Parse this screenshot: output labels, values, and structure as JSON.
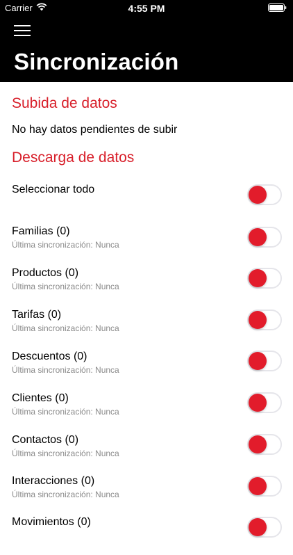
{
  "status_bar": {
    "carrier": "Carrier",
    "time": "4:55 PM",
    "wifi_icon": "wifi-icon",
    "battery_icon": "battery-icon"
  },
  "header": {
    "menu_icon": "hamburger-menu-icon",
    "title": "Sincronización"
  },
  "upload": {
    "title": "Subida de datos",
    "message": "No hay datos pendientes de subir"
  },
  "download": {
    "title": "Descarga de datos",
    "select_all": {
      "label": "Seleccionar todo",
      "enabled": false
    },
    "items": [
      {
        "label": "Familias (0)",
        "sub": "Última sincronización: Nunca",
        "enabled": false
      },
      {
        "label": "Productos (0)",
        "sub": "Última sincronización: Nunca",
        "enabled": false
      },
      {
        "label": "Tarifas (0)",
        "sub": "Última sincronización: Nunca",
        "enabled": false
      },
      {
        "label": "Descuentos (0)",
        "sub": "Última sincronización: Nunca",
        "enabled": false
      },
      {
        "label": "Clientes (0)",
        "sub": "Última sincronización: Nunca",
        "enabled": false
      },
      {
        "label": "Contactos (0)",
        "sub": "Última sincronización: Nunca",
        "enabled": false
      },
      {
        "label": "Interacciones (0)",
        "sub": "Última sincronización: Nunca",
        "enabled": false
      },
      {
        "label": "Movimientos (0)",
        "sub": "",
        "enabled": false
      }
    ]
  },
  "colors": {
    "accent": "#d81f2a",
    "toggle_knob": "#e21c2b",
    "header_bg": "#000000",
    "subtext": "#8a8a8a"
  }
}
